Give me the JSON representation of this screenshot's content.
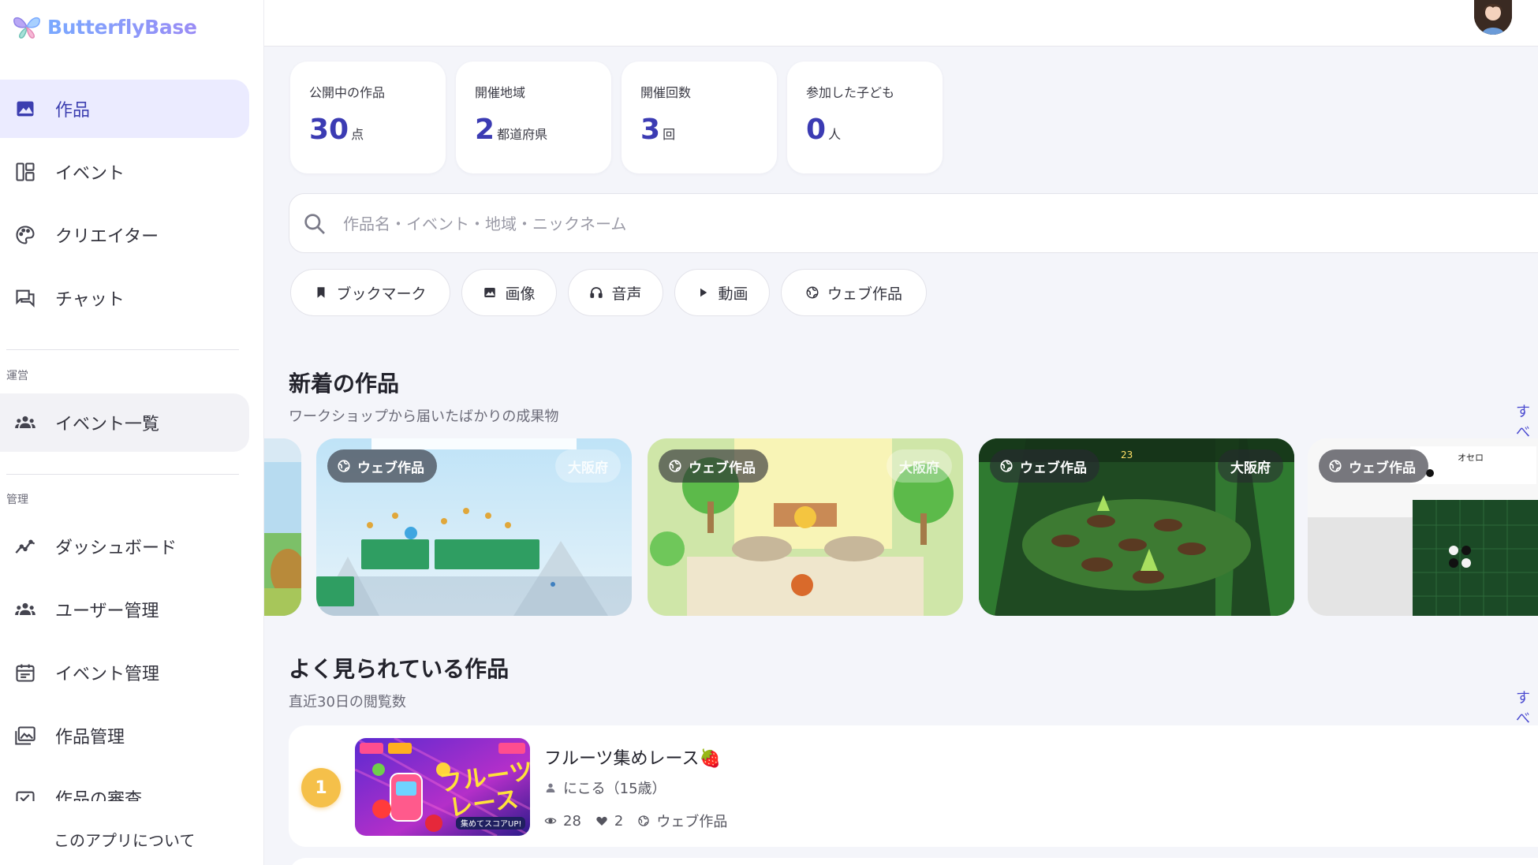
{
  "app": {
    "name": "ButterflyBase"
  },
  "sidebar": {
    "items": [
      {
        "label": "作品",
        "icon": "image-icon"
      },
      {
        "label": "イベント",
        "icon": "dashboard-layout-icon"
      },
      {
        "label": "クリエイター",
        "icon": "palette-icon"
      },
      {
        "label": "チャット",
        "icon": "chat-icon"
      }
    ],
    "section_ops": "運営",
    "ops_items": [
      {
        "label": "イベント一覧",
        "icon": "group-icon"
      }
    ],
    "section_admin": "管理",
    "admin_items": [
      {
        "label": "ダッシュボード",
        "icon": "trend-icon"
      },
      {
        "label": "ユーザー管理",
        "icon": "group-icon"
      },
      {
        "label": "イベント管理",
        "icon": "calendar-icon"
      },
      {
        "label": "作品管理",
        "icon": "gallery-icon"
      },
      {
        "label": "作品の審査",
        "icon": "review-icon"
      }
    ],
    "about": "このアプリについて"
  },
  "stats": [
    {
      "label": "公開中の作品",
      "value": "30",
      "unit": "点"
    },
    {
      "label": "開催地域",
      "value": "2",
      "unit": "都道府県"
    },
    {
      "label": "開催回数",
      "value": "3",
      "unit": "回"
    },
    {
      "label": "参加した子ども",
      "value": "0",
      "unit": "人"
    }
  ],
  "search": {
    "placeholder": "作品名・イベント・地域・ニックネーム"
  },
  "filters": [
    {
      "label": "ブックマーク",
      "icon": "bookmark-icon"
    },
    {
      "label": "画像",
      "icon": "image-icon"
    },
    {
      "label": "音声",
      "icon": "headphones-icon"
    },
    {
      "label": "動画",
      "icon": "play-icon"
    },
    {
      "label": "ウェブ作品",
      "icon": "globe-icon"
    }
  ],
  "new_works": {
    "title": "新着の作品",
    "subtitle": "ワークショップから届いたばかりの成果物",
    "see_all": "すべ",
    "cards": [
      {
        "badge": "ウェブ作品",
        "region": "大阪府"
      },
      {
        "badge": "ウェブ作品",
        "region": "大阪府"
      },
      {
        "badge": "ウェブ作品",
        "region": "大阪府"
      },
      {
        "badge": "ウェブ作品",
        "region": ""
      }
    ]
  },
  "popular": {
    "title": "よく見られている作品",
    "subtitle": "直近30日の閲覧数",
    "see_all": "すべ",
    "items": [
      {
        "rank": "1",
        "title": "フルーツ集めレース🍓",
        "author": "にこる（15歳）",
        "views": "28",
        "likes": "2",
        "type": "ウェブ作品"
      }
    ]
  }
}
